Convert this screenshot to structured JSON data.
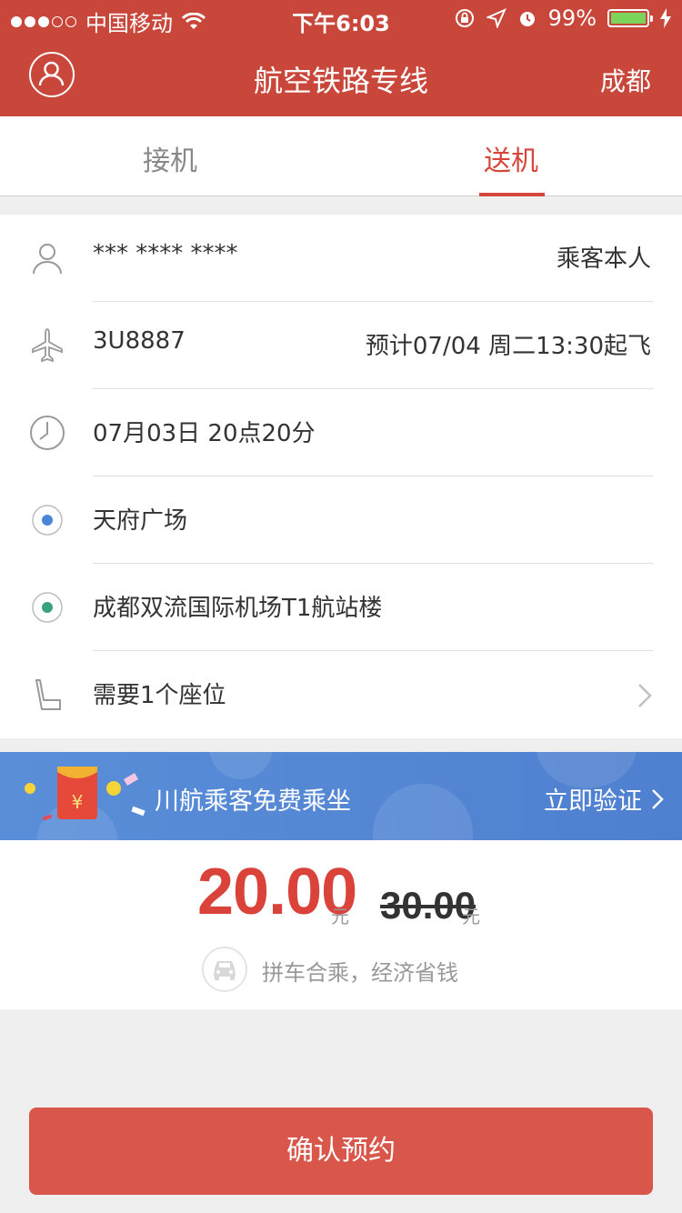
{
  "status_bar": {
    "carrier": "中国移动",
    "time": "下午6:03",
    "battery": "99%",
    "battery_level": 0.99
  },
  "header": {
    "title": "航空铁路专线",
    "city": "成都"
  },
  "tabs": [
    {
      "label": "接机",
      "active": false
    },
    {
      "label": "送机",
      "active": true
    }
  ],
  "form": {
    "passenger": {
      "name": "*** **** ****",
      "value": "乘客本人"
    },
    "flight": {
      "number": "3U8887",
      "eta": "预计07/04 周二13:30起飞"
    },
    "time": {
      "value": "07月03日 20点20分"
    },
    "pickup": {
      "value": "天府广场"
    },
    "dropoff": {
      "value": "成都双流国际机场T1航站楼"
    },
    "seats": {
      "value": "需要1个座位"
    }
  },
  "banner": {
    "text": "川航乘客免费乘坐",
    "action": "立即验证"
  },
  "price": {
    "current": "20.00",
    "unit": "元",
    "original": "30.00",
    "original_unit": "元",
    "note": "拼车合乘，经济省钱"
  },
  "confirm_button": "确认预约",
  "colors": {
    "brand": "#c8473a",
    "accent": "#d6463a",
    "banner": "#5a8ed8",
    "button": "#d9574a"
  }
}
